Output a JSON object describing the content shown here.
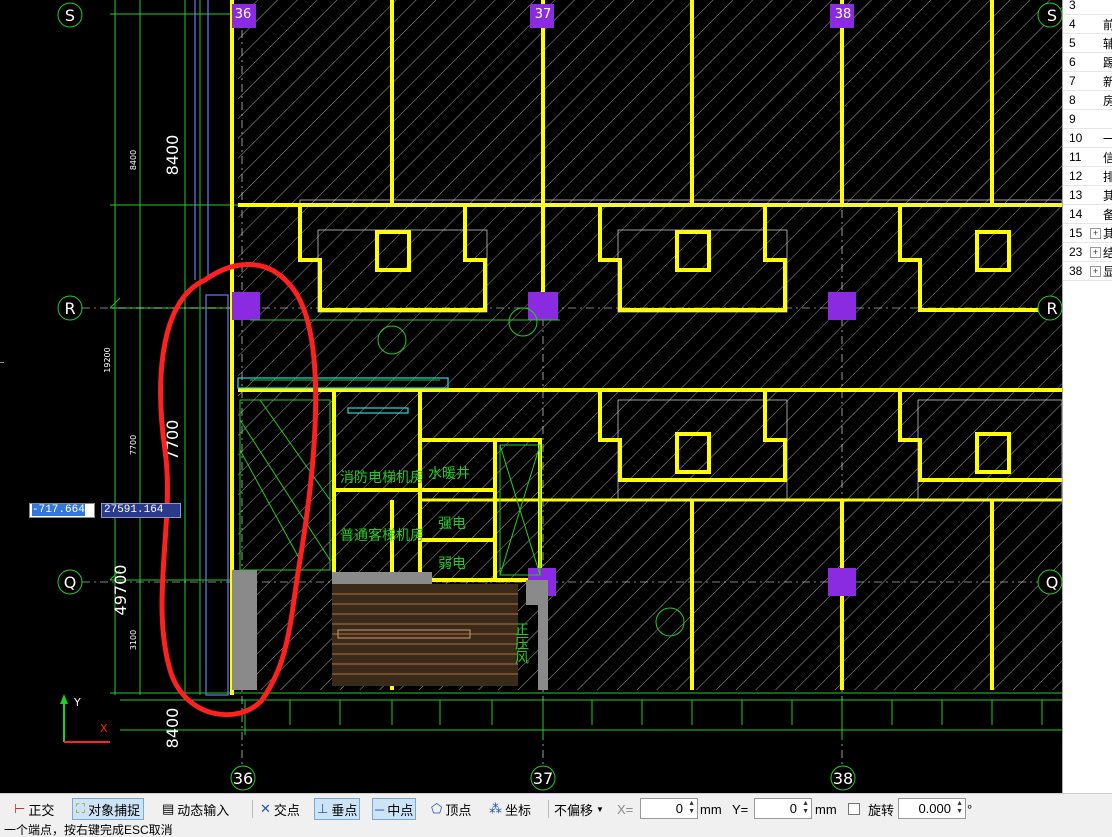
{
  "axis_labels": {
    "grid_s": "S",
    "grid_r": "R",
    "grid_q": "Q",
    "grid_36": "36",
    "grid_37": "37",
    "grid_38": "38"
  },
  "dimensions": {
    "d_8400_top": "8400",
    "d_8400_small": "8400",
    "d_19200": "19200",
    "d_7700_small": "7700",
    "d_7700": "7700",
    "d_49700": "49700",
    "d_3100": "3100",
    "d_8400_bottom": "8400"
  },
  "room_labels": {
    "fire_elevator_room": "消防电梯机房",
    "passenger_elevator_room": "普通客梯机房",
    "water_well": "水暖井",
    "strong_current": "强电",
    "weak_current": "弱电",
    "stair_label": "正压风"
  },
  "coord_input": {
    "x_value": "-717.664",
    "y_value": "27591.164"
  },
  "right_panel": {
    "rows": [
      {
        "num": "3",
        "expand": "",
        "char": ""
      },
      {
        "num": "4",
        "expand": "",
        "char": "前"
      },
      {
        "num": "5",
        "expand": "",
        "char": "辅"
      },
      {
        "num": "6",
        "expand": "",
        "char": "踢"
      },
      {
        "num": "7",
        "expand": "",
        "char": "新"
      },
      {
        "num": "8",
        "expand": "",
        "char": "房"
      },
      {
        "num": "9",
        "expand": "",
        "char": ""
      },
      {
        "num": "10",
        "expand": "",
        "char": "一"
      },
      {
        "num": "11",
        "expand": "",
        "char": "信"
      },
      {
        "num": "12",
        "expand": "",
        "char": "排"
      },
      {
        "num": "13",
        "expand": "",
        "char": "其"
      },
      {
        "num": "14",
        "expand": "",
        "char": "备"
      },
      {
        "num": "15",
        "expand": "+",
        "char": "其"
      },
      {
        "num": "23",
        "expand": "+",
        "char": "结"
      },
      {
        "num": "38",
        "expand": "+",
        "char": "显"
      }
    ]
  },
  "toolbar": {
    "ortho": "正交",
    "osnap": "对象捕捉",
    "dyn_input": "动态输入",
    "intersection": "交点",
    "perpendicular": "垂点",
    "midpoint": "中点",
    "vertex": "顶点",
    "coordinate": "坐标",
    "offset_select": "不偏移",
    "x_label": "X=",
    "x_value": "0",
    "x_unit": "mm",
    "y_label": "Y=",
    "y_value": "0",
    "y_unit": "mm",
    "rotate_label": "旋转",
    "rotate_value": "0.000",
    "degree": "°"
  },
  "status": {
    "prompt": "一个端点，按右键完成ESC取消"
  },
  "colors": {
    "canvas_bg": "#000000",
    "wall_yellow": "#ffff00",
    "dim_green": "#22cc22",
    "column_purple": "#8a2be2",
    "markup_red": "#ff2020",
    "axis_white": "#ffffff"
  }
}
